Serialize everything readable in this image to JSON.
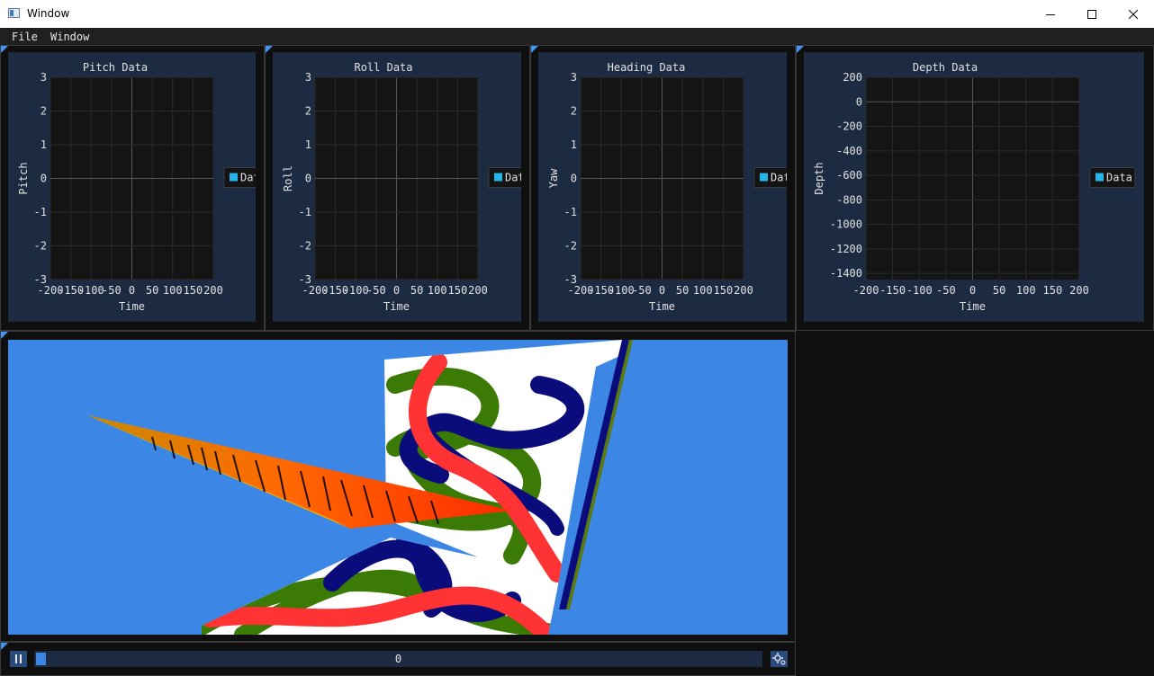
{
  "window": {
    "title": "Window",
    "minimize_icon": "minimize-icon",
    "maximize_icon": "maximize-icon",
    "close_icon": "close-icon"
  },
  "menu": {
    "items": [
      "File",
      "Window"
    ]
  },
  "plots": [
    {
      "title": "Pitch Data",
      "xlabel": "Time",
      "ylabel": "Pitch",
      "legend": "Data",
      "legend_color": "#26b5e8",
      "chart_data": {
        "type": "line",
        "x_ticks": [
          "-200",
          "-150",
          "-100",
          "-50",
          "0",
          "50",
          "100",
          "150",
          "200"
        ],
        "y_ticks": [
          "3",
          "2",
          "1",
          "0",
          "-1",
          "-2",
          "-3"
        ],
        "xlim": [
          -200,
          200
        ],
        "ylim": [
          -3,
          3
        ],
        "series": [
          {
            "name": "Data",
            "x": [],
            "y": []
          }
        ],
        "grid": true,
        "legend_placement": "right"
      }
    },
    {
      "title": "Roll Data",
      "xlabel": "Time",
      "ylabel": "Roll",
      "legend": "Data",
      "legend_color": "#26b5e8",
      "chart_data": {
        "type": "line",
        "x_ticks": [
          "-200",
          "-150",
          "-100",
          "-50",
          "0",
          "50",
          "100",
          "150",
          "200"
        ],
        "y_ticks": [
          "3",
          "2",
          "1",
          "0",
          "-1",
          "-2",
          "-3"
        ],
        "xlim": [
          -200,
          200
        ],
        "ylim": [
          -3,
          3
        ],
        "series": [
          {
            "name": "Data",
            "x": [],
            "y": []
          }
        ],
        "grid": true,
        "legend_placement": "right"
      }
    },
    {
      "title": "Heading Data",
      "xlabel": "Time",
      "ylabel": "Yaw",
      "legend": "Data",
      "legend_color": "#26b5e8",
      "chart_data": {
        "type": "line",
        "x_ticks": [
          "-200",
          "-150",
          "-100",
          "-50",
          "0",
          "50",
          "100",
          "150",
          "200"
        ],
        "y_ticks": [
          "3",
          "2",
          "1",
          "0",
          "-1",
          "-2",
          "-3"
        ],
        "xlim": [
          -200,
          200
        ],
        "ylim": [
          -3,
          3
        ],
        "series": [
          {
            "name": "Data",
            "x": [],
            "y": []
          }
        ],
        "grid": true,
        "legend_placement": "right"
      }
    },
    {
      "title": "Depth Data",
      "xlabel": "Time",
      "ylabel": "Depth",
      "legend": "Data",
      "legend_color": "#26b5e8",
      "chart_data": {
        "type": "line",
        "x_ticks": [
          "-200",
          "-150",
          "-100",
          "-50",
          "0",
          "50",
          "100",
          "150",
          "200"
        ],
        "y_ticks": [
          "200",
          "0",
          "-200",
          "-400",
          "-600",
          "-800",
          "-1000",
          "-1200",
          "-1400"
        ],
        "xlim": [
          -200,
          200
        ],
        "ylim": [
          -1450,
          200
        ],
        "series": [
          {
            "name": "Data",
            "x": [],
            "y": []
          }
        ],
        "grid": true,
        "legend_placement": "right"
      }
    }
  ],
  "playback": {
    "pause_icon": "pause-icon",
    "progress_value": "0",
    "progress_fraction": 0.014,
    "settings_icon": "settings-icon"
  },
  "colors": {
    "window_bg": "#0f0f0f",
    "plot_frame_bg": "#1d2b42",
    "plot_bg": "#141414",
    "accent": "#4296fa",
    "legend": "#26b5e8",
    "scene_sky": "#3c87e6",
    "scene_red": "#ff3333",
    "scene_navy": "#0b0c7c",
    "scene_green": "#3a7a05"
  }
}
